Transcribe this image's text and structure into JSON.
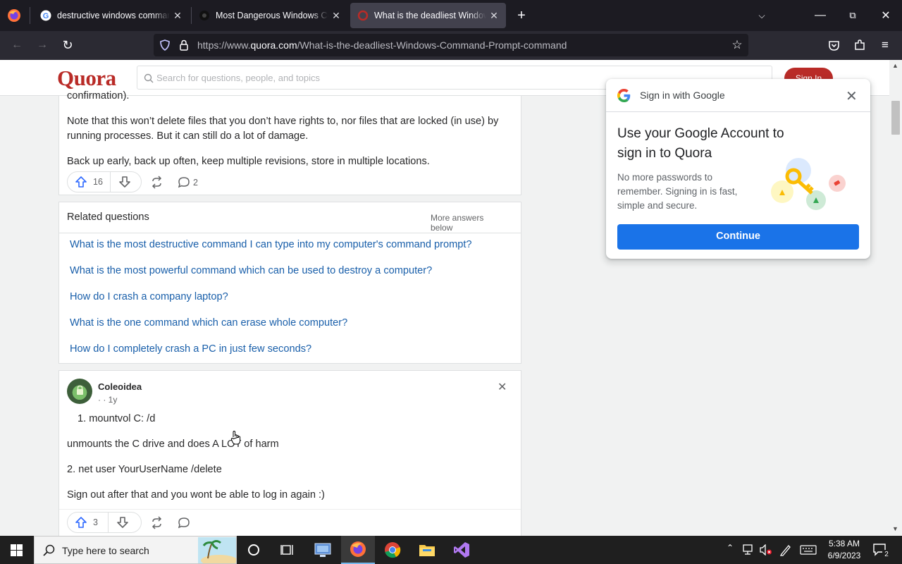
{
  "browser": {
    "tabs": [
      {
        "title": "destructive windows command",
        "active": false
      },
      {
        "title": "Most Dangerous Windows Com",
        "active": false
      },
      {
        "title": "What is the deadliest Windows",
        "active": true
      }
    ],
    "url_prefix": "https://www.",
    "url_domain": "quora.com",
    "url_path": "/What-is-the-deadliest-Windows-Command-Prompt-command"
  },
  "quora": {
    "logo": "Quora",
    "search_placeholder": "Search for questions, people, and topics",
    "signin_label": "Sign In"
  },
  "answer1": {
    "partial_line": "confirmation).",
    "para1_line1": "Note that this won’t delete files that you don’t have rights to, nor files that are locked (in use) by",
    "para1_line2": "running processes. But it can still do a lot of damage.",
    "para2": "Back up early, back up often, keep multiple revisions, store in multiple locations.",
    "upvotes": "16",
    "comments": "2"
  },
  "related": {
    "header": "Related questions",
    "more": "More answers below",
    "questions": [
      "What is the most destructive command I can type into my computer's command prompt?",
      "What is the most powerful command which can be used to destroy a computer?",
      "How do I crash a company laptop?",
      "What is the one command which can erase whole computer?",
      "How do I completely crash a PC in just few seconds?"
    ]
  },
  "answer2": {
    "author": "Coleoidea",
    "meta": "· · 1y",
    "line1": "1. mountvol C: /d",
    "line2": "unmounts the C drive and does A LOT of harm",
    "line3": "2. net user YourUserName /delete",
    "line4": "Sign out after that and you wont be able to log in again :)",
    "upvotes": "3"
  },
  "google_popup": {
    "title": "Sign in with Google",
    "heading": "Use your Google Account to sign in to Quora",
    "description": "No more passwords to remember. Signing in is fast, simple and secure.",
    "continue_label": "Continue"
  },
  "taskbar": {
    "search_placeholder": "Type here to search",
    "time": "5:38 AM",
    "date": "6/9/2023",
    "notification_count": "2"
  },
  "colors": {
    "quora_red": "#b92b27",
    "link_blue": "#195faa",
    "google_blue": "#1a73e8"
  }
}
